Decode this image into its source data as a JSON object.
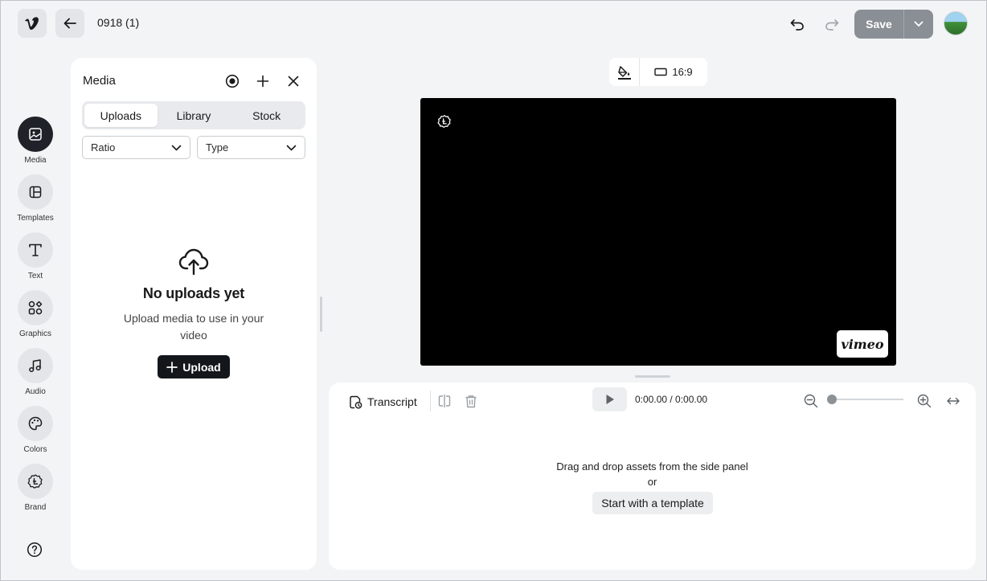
{
  "header": {
    "project_title": "0918 (1)",
    "save_label": "Save"
  },
  "sidebar": {
    "items": [
      {
        "label": "Media",
        "icon": "image-icon"
      },
      {
        "label": "Templates",
        "icon": "templates-icon"
      },
      {
        "label": "Text",
        "icon": "text-icon"
      },
      {
        "label": "Graphics",
        "icon": "graphics-icon"
      },
      {
        "label": "Audio",
        "icon": "music-note-icon"
      },
      {
        "label": "Colors",
        "icon": "palette-icon"
      },
      {
        "label": "Brand",
        "icon": "brand-icon"
      }
    ],
    "help_icon": "help-icon"
  },
  "media_panel": {
    "title": "Media",
    "tabs": [
      "Uploads",
      "Library",
      "Stock"
    ],
    "active_tab": "Uploads",
    "filters": {
      "ratio": "Ratio",
      "type": "Type"
    },
    "empty_title": "No uploads yet",
    "empty_subtitle": "Upload media to use in your video",
    "upload_label": "Upload"
  },
  "canvas": {
    "aspect_ratio": "16:9",
    "watermark": "vimeo"
  },
  "timeline": {
    "transcript_label": "Transcript",
    "timecode": "0:00.00 / 0:00.00",
    "drop_hint": "Drag and drop assets from the side panel",
    "or_text": "or",
    "template_button": "Start with a template"
  },
  "colors": {
    "accent_dark": "#1f2329",
    "save_disabled": "#8a8f95",
    "background": "#f3f4f6"
  }
}
